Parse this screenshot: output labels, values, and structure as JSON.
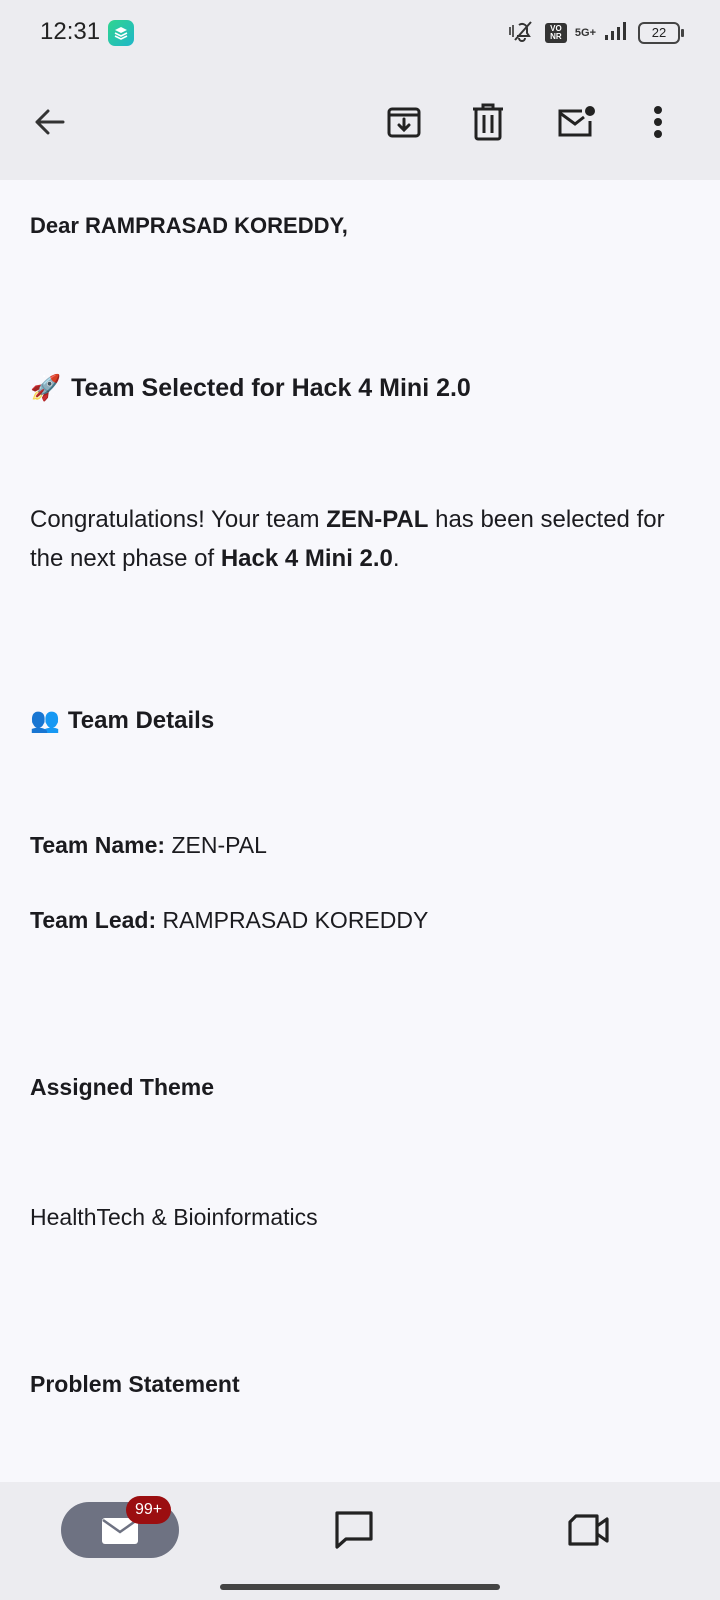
{
  "status_bar": {
    "time": "12:31",
    "network_vo": "VO NR",
    "network_type": "5G+",
    "battery": "22"
  },
  "toolbar": {
    "icons": [
      "back-arrow-icon",
      "archive-icon",
      "delete-icon",
      "mark-unread-icon",
      "more-vert-icon"
    ]
  },
  "email": {
    "greeting": "Dear RAMPRASAD KOREDDY,",
    "heading_emoji": "🚀",
    "heading": "Team Selected for Hack 4 Mini 2.0",
    "congrats_p1": "Congratulations! Your team ",
    "team_name_bold": "ZEN-PAL",
    "congrats_p2": " has been selected for the next phase of ",
    "event_bold": "Hack 4 Mini 2.0",
    "congrats_p3": ".",
    "team_details_emoji": "👥",
    "team_details_heading": "Team Details",
    "team_name_label": "Team Name:",
    "team_name_value": " ZEN-PAL",
    "team_lead_label": "Team Lead:",
    "team_lead_value": " RAMPRASAD KOREDDY",
    "assigned_theme_heading": "Assigned Theme",
    "assigned_theme_value": "HealthTech & Bioinformatics",
    "problem_statement_heading": "Problem Statement"
  },
  "bottom_nav": {
    "mail_badge": "99+",
    "items": [
      "mail-icon",
      "chat-icon",
      "meet-icon"
    ]
  },
  "colors": {
    "background": "#F8F8FC",
    "bars": "#ECECF0",
    "pill": "#6E7282",
    "badge": "#9B0E10"
  }
}
